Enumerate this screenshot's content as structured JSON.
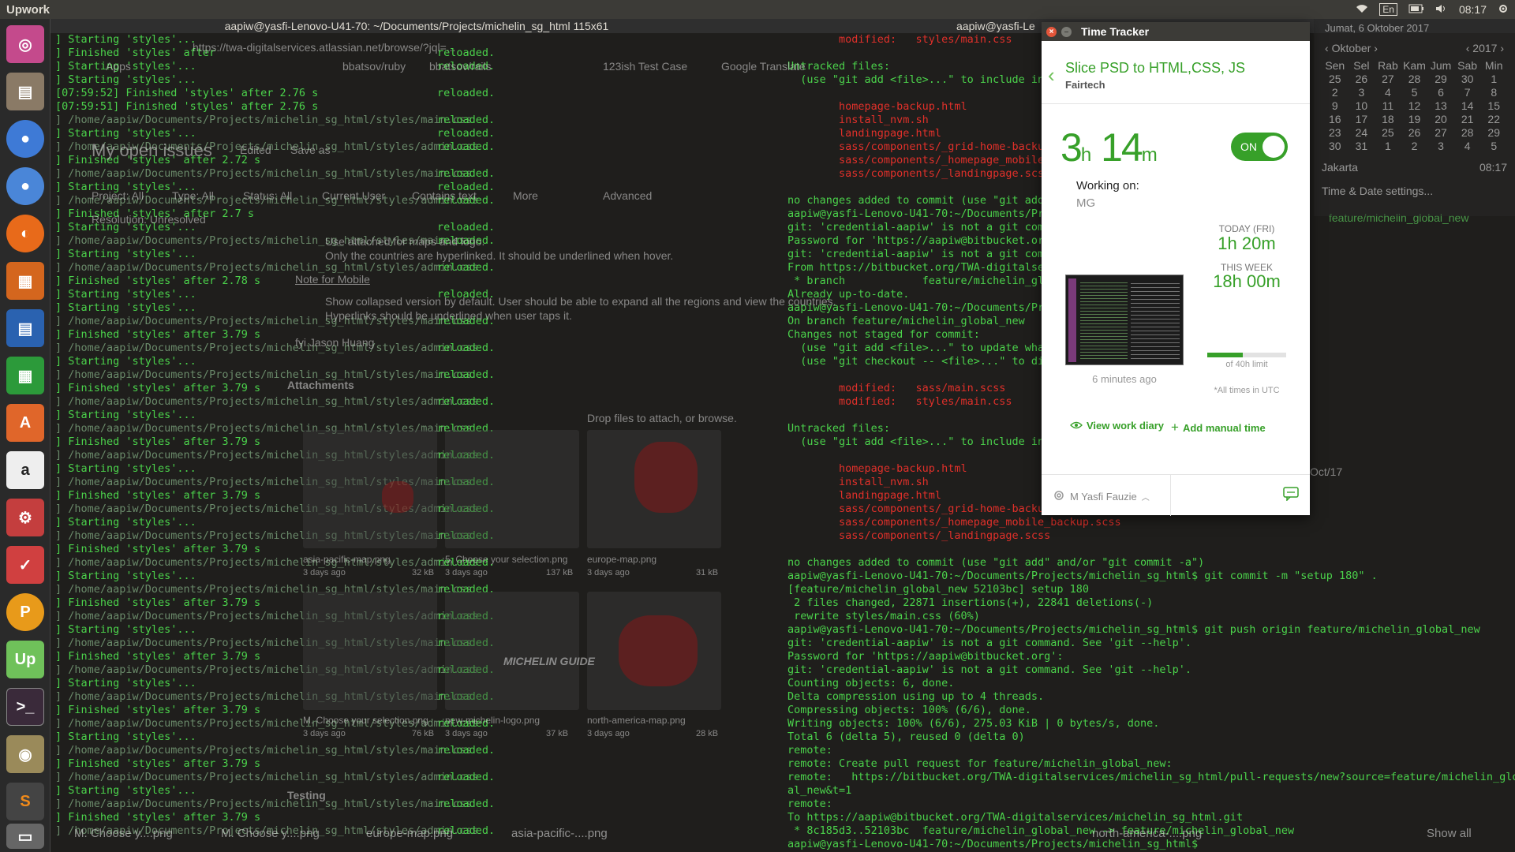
{
  "topbar": {
    "app_name": "Upwork",
    "indicators": [
      "En",
      "08:17"
    ]
  },
  "launcher": {
    "icons": [
      "ubuntu-icon",
      "files-icon",
      "chrome-icon",
      "chromium-icon",
      "firefox-icon",
      "document-viewer-icon",
      "writer-icon",
      "calc-icon",
      "software-center-icon",
      "amazon-icon",
      "settings-icon",
      "search-tool-icon",
      "pgadmin-icon",
      "upwork-icon",
      "terminal-icon",
      "image-viewer-icon",
      "sublime-icon",
      "trash-icon"
    ]
  },
  "terminal_left": {
    "title": "aapiw@yasfi-Lenovo-U41-70: ~/Documents/Projects/michelin_sg_html 115x61",
    "lines": [
      [
        "] Starting 'styles'...",
        ""
      ],
      [
        "] Finished 'styles' after",
        "reloaded."
      ],
      [
        "] Starting 'styles'...",
        "reloaded."
      ],
      [
        "] Starting 'styles'...",
        ""
      ],
      [
        "[07:59:52] Finished 'styles' after 2.76 s",
        "reloaded."
      ],
      [
        "[07:59:51] Finished 'styles' after 2.76 s",
        ""
      ],
      [
        "] /home/aapiw/Documents/Projects/michelin_sg_html/styles/main.css",
        "reloaded."
      ],
      [
        "] Starting 'styles'...",
        "reloaded."
      ],
      [
        "] /home/aapiw/Documents/Projects/michelin_sg_html/styles/admin.css",
        "reloaded."
      ],
      [
        "] Finished 'styles' after 2.72 s",
        ""
      ],
      [
        "] /home/aapiw/Documents/Projects/michelin_sg_html/styles/main.css",
        "reloaded."
      ],
      [
        "] Starting 'styles'...",
        "reloaded."
      ],
      [
        "] /home/aapiw/Documents/Projects/michelin_sg_html/styles/admin.css",
        "reloaded."
      ],
      [
        "] Finished 'styles' after 2.7 s",
        ""
      ],
      [
        "] Starting 'styles'...",
        "reloaded."
      ],
      [
        "] /home/aapiw/Documents/Projects/michelin_sg_html/styles/main.css",
        "reloaded."
      ],
      [
        "] Starting 'styles'...",
        ""
      ],
      [
        "] /home/aapiw/Documents/Projects/michelin_sg_html/styles/admin.css",
        "reloaded."
      ],
      [
        "] Finished 'styles' after 2.78 s",
        ""
      ],
      [
        "] Starting 'styles'...",
        "reloaded."
      ]
    ],
    "repeat_block": [
      [
        "] Starting 'styles'...",
        ""
      ],
      [
        "] /home/aapiw/Documents/Projects/michelin_sg_html/styles/main.css",
        "reloaded."
      ],
      [
        "] Finished 'styles' after 3.79 s",
        ""
      ],
      [
        "] /home/aapiw/Documents/Projects/michelin_sg_html/styles/admin.css",
        "reloaded."
      ]
    ]
  },
  "ghost_page": {
    "url": "https://twa-digitalservices.atlassian.net/browse/?jql=...",
    "bookmarks": [
      "Apps",
      "bbatsov/ruby",
      "bbatsov/rails",
      "123ish Test Case",
      "Google Translate"
    ],
    "title": "My open issues",
    "edited": "Edited",
    "save_as": "Save as",
    "filters": [
      "Project: All",
      "Type: All",
      "Status: All",
      "Current User",
      "Contains text",
      "More",
      "Advanced"
    ],
    "resolution": "Resolution: Unresolved",
    "bullets": [
      "Use attached for maps and logo.",
      "Only the countries are hyperlinked. It should be underlined when hover."
    ],
    "note": "Note for Mobile",
    "bullets2": [
      "Show collapsed version by default. User should be able to expand all the regions and view the countries.",
      "Hyperlinks should be underlined when user taps it."
    ],
    "fyi": "fyi Jason Huang",
    "attachments": "Attachments",
    "drop": "Drop files to attach, or browse.",
    "files": [
      {
        "name": "asia-pacific-map.png",
        "ago": "3 days ago",
        "size": "32 kB"
      },
      {
        "name": "5. Choose your selection.png",
        "ago": "3 days ago",
        "size": "137 kB"
      },
      {
        "name": "europe-map.png",
        "ago": "3 days ago",
        "size": "31 kB"
      },
      {
        "name": "M. Choose your selection.png",
        "ago": "3 days ago",
        "size": "76 kB"
      },
      {
        "name": "new-michelin-logo.png",
        "ago": "3 days ago",
        "size": "37 kB"
      },
      {
        "name": "north-america-map.png",
        "ago": "3 days ago",
        "size": "28 kB"
      }
    ],
    "logo_text": "MICHELIN GUIDE",
    "testing": "Testing",
    "date_fragment": "Oct/17"
  },
  "terminal_right": {
    "title": "aapiw@yasfi-Le",
    "lines": [
      {
        "t": "        modified:   styles/main.css",
        "c": "r"
      },
      {
        "t": "",
        "c": "w"
      },
      {
        "t": "Untracked files:",
        "c": "g"
      },
      {
        "t": "  (use \"git add <file>...\" to include in",
        "c": "g"
      },
      {
        "t": "",
        "c": "w"
      },
      {
        "t": "        homepage-backup.html",
        "c": "r"
      },
      {
        "t": "        install_nvm.sh",
        "c": "r"
      },
      {
        "t": "        landingpage.html",
        "c": "r"
      },
      {
        "t": "        sass/components/_grid-home-backu",
        "c": "r"
      },
      {
        "t": "        sass/components/_homepage_mobile",
        "c": "r"
      },
      {
        "t": "        sass/components/_landingpage.scs",
        "c": "r"
      },
      {
        "t": "",
        "c": "w"
      },
      {
        "t": "no changes added to commit (use \"git add",
        "c": "g"
      },
      {
        "t": "aapiw@yasfi-Lenovo-U41-70:~/Documents/Pr",
        "c": "g"
      },
      {
        "t": "git: 'credential-aapiw' is not a git com",
        "c": "g"
      },
      {
        "t": "Password for 'https://aapiw@bitbucket.or",
        "c": "g"
      },
      {
        "t": "git: 'credential-aapiw' is not a git com",
        "c": "g"
      },
      {
        "t": "From https://bitbucket.org/TWA-digitalse",
        "c": "g"
      },
      {
        "t": " * branch            feature/michelin_gl",
        "c": "g"
      },
      {
        "t": "Already up-to-date.",
        "c": "g"
      },
      {
        "t": "aapiw@yasfi-Lenovo-U41-70:~/Documents/Pr",
        "c": "g"
      },
      {
        "t": "On branch feature/michelin_global_new",
        "c": "g"
      },
      {
        "t": "Changes not staged for commit:",
        "c": "g"
      },
      {
        "t": "  (use \"git add <file>...\" to update wha",
        "c": "g"
      },
      {
        "t": "  (use \"git checkout -- <file>...\" to di",
        "c": "g"
      },
      {
        "t": "",
        "c": "w"
      },
      {
        "t": "        modified:   sass/main.scss",
        "c": "r"
      },
      {
        "t": "        modified:   styles/main.css",
        "c": "r"
      },
      {
        "t": "",
        "c": "w"
      },
      {
        "t": "Untracked files:",
        "c": "g"
      },
      {
        "t": "  (use \"git add <file>...\" to include in",
        "c": "g"
      },
      {
        "t": "",
        "c": "w"
      },
      {
        "t": "        homepage-backup.html",
        "c": "r"
      },
      {
        "t": "        install_nvm.sh",
        "c": "r"
      },
      {
        "t": "        landingpage.html",
        "c": "r"
      },
      {
        "t": "        sass/components/_grid-home-backup.scss",
        "c": "r"
      },
      {
        "t": "        sass/components/_homepage_mobile_backup.scss",
        "c": "r"
      },
      {
        "t": "        sass/components/_landingpage.scss",
        "c": "r"
      },
      {
        "t": "",
        "c": "w"
      },
      {
        "t": "no changes added to commit (use \"git add\" and/or \"git commit -a\")",
        "c": "g"
      },
      {
        "t": "aapiw@yasfi-Lenovo-U41-70:~/Documents/Projects/michelin_sg_html$ git commit -m \"setup 180\" .",
        "c": "g"
      },
      {
        "t": "[feature/michelin_global_new 52103bc] setup 180",
        "c": "g"
      },
      {
        "t": " 2 files changed, 22871 insertions(+), 22841 deletions(-)",
        "c": "g"
      },
      {
        "t": " rewrite styles/main.css (60%)",
        "c": "g"
      },
      {
        "t": "aapiw@yasfi-Lenovo-U41-70:~/Documents/Projects/michelin_sg_html$ git push origin feature/michelin_global_new",
        "c": "g"
      },
      {
        "t": "git: 'credential-aapiw' is not a git command. See 'git --help'.",
        "c": "g"
      },
      {
        "t": "Password for 'https://aapiw@bitbucket.org':",
        "c": "g"
      },
      {
        "t": "git: 'credential-aapiw' is not a git command. See 'git --help'.",
        "c": "g"
      },
      {
        "t": "Counting objects: 6, done.",
        "c": "g"
      },
      {
        "t": "Delta compression using up to 4 threads.",
        "c": "g"
      },
      {
        "t": "Compressing objects: 100% (6/6), done.",
        "c": "g"
      },
      {
        "t": "Writing objects: 100% (6/6), 275.03 KiB | 0 bytes/s, done.",
        "c": "g"
      },
      {
        "t": "Total 6 (delta 5), reused 0 (delta 0)",
        "c": "g"
      },
      {
        "t": "remote:",
        "c": "g"
      },
      {
        "t": "remote: Create pull request for feature/michelin_global_new:",
        "c": "g"
      },
      {
        "t": "remote:   https://bitbucket.org/TWA-digitalservices/michelin_sg_html/pull-requests/new?source=feature/michelin_glob",
        "c": "g"
      },
      {
        "t": "al_new&t=1",
        "c": "g"
      },
      {
        "t": "remote:",
        "c": "g"
      },
      {
        "t": "To https://aapiw@bitbucket.org/TWA-digitalservices/michelin_sg_html.git",
        "c": "g"
      },
      {
        "t": " * 8c185d3..52103bc  feature/michelin_global_new -> feature/michelin_global_new",
        "c": "g"
      },
      {
        "t": "aapiw@yasfi-Lenovo-U41-70:~/Documents/Projects/michelin_sg_html$ ",
        "c": "g"
      }
    ],
    "side_fragment": "feature/michelin_global_new"
  },
  "calendar": {
    "date_header": "Jumat, 6 Oktober 2017",
    "month": "Oktober",
    "year": "2017",
    "weekdays": [
      "Sen",
      "Sel",
      "Rab",
      "Kam",
      "Jum",
      "Sab",
      "Min"
    ],
    "days": [
      "25",
      "26",
      "27",
      "28",
      "29",
      "30",
      "1",
      "2",
      "3",
      "4",
      "5",
      "6",
      "7",
      "8",
      "9",
      "10",
      "11",
      "12",
      "13",
      "14",
      "15",
      "16",
      "17",
      "18",
      "19",
      "20",
      "21",
      "22",
      "23",
      "24",
      "25",
      "26",
      "27",
      "28",
      "29",
      "30",
      "31",
      "1",
      "2",
      "3",
      "4",
      "5"
    ],
    "location": "Jakarta",
    "location_time": "08:17",
    "settings": "Time & Date settings..."
  },
  "time_tracker": {
    "window_title": "Time Tracker",
    "task_title": "Slice PSD to HTML,CSS, JS",
    "client": "Fairtech",
    "hours": "3",
    "hours_unit": "h",
    "minutes": "14",
    "minutes_unit": "m",
    "toggle_label": "ON",
    "toggle_on": true,
    "working_on_label": "Working on:",
    "memo": "MG",
    "screenshot_ago": "6 minutes ago",
    "today_label": "TODAY (FRI)",
    "today_value": "1h 20m",
    "week_label": "THIS WEEK",
    "week_value": "18h 00m",
    "week_progress": 0.45,
    "limit_label": "of 40h limit",
    "utc_note": "*All times in UTC",
    "view_diary": "View work diary",
    "add_manual": "Add manual time",
    "user_name": "M Yasfi Fauzie",
    "accent": "#37a029"
  },
  "taskbar": {
    "items": [
      "M. Choose y....png",
      "M. Choose y....png",
      "europe-map.png",
      "asia-pacific-....png",
      "north-america-....png"
    ],
    "show_all": "Show all"
  }
}
